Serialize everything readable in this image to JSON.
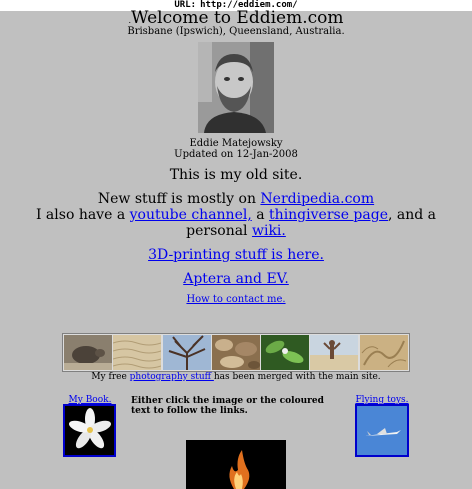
{
  "url_bar": {
    "label": "URL:",
    "url": "http://eddiem.com/"
  },
  "header": {
    "dot": ".",
    "title": "Welcome to Eddiem.com",
    "location": "Brisbane (Ipswich), Queensland, Australia."
  },
  "profile": {
    "name": "Eddie Matejowsky",
    "updated": "Updated on 12-Jan-2008"
  },
  "intro": {
    "old_site": "This is my old site.",
    "new_prefix": "New stuff is mostly on ",
    "new_link": "Nerdipedia.com",
    "also_prefix": "I also have a ",
    "youtube_link": "youtube channel,",
    "also_mid": " a ",
    "thingiverse_link": "thingiverse page",
    "also_suffix": ", and a personal ",
    "wiki_link": "wiki."
  },
  "links": {
    "printing": "3D-printing stuff is here.",
    "aptera": "Aptera and EV.",
    "contact": "How to contact me."
  },
  "photo_strip": {
    "thumbs": [
      "turtle-thumb",
      "sand-ripples-thumb",
      "tree-branches-thumb",
      "rocks-thumb",
      "leaves-thumb",
      "beach-person-thumb",
      "sand-pattern-thumb"
    ],
    "caption_prefix": "My free ",
    "caption_link": "photography stuff ",
    "caption_suffix": "has been merged with the main site."
  },
  "book": {
    "label": "My Book."
  },
  "toys": {
    "label": "Flying toys."
  },
  "instructions": "Either click the image or the coloured text to follow the links."
}
